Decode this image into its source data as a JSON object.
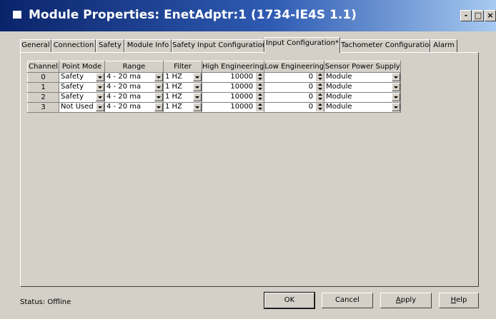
{
  "window": {
    "title": "Module Properties: EnetAdptr:1 (1734-IE4S 1.1)",
    "minimize_label": "-",
    "restore_label": "□",
    "close_label": "×"
  },
  "tabs": [
    {
      "label": "General"
    },
    {
      "label": "Connection"
    },
    {
      "label": "Safety"
    },
    {
      "label": "Module Info"
    },
    {
      "label": "Safety Input Configuration"
    },
    {
      "label": "Input Configuration*",
      "active": true
    },
    {
      "label": "Tachometer Configuration"
    },
    {
      "label": "Alarm"
    }
  ],
  "table": {
    "headers": [
      "Channel",
      "Point Mode",
      "Range",
      "Filter",
      "High Engineering",
      "Low Engineering",
      "Sensor Power Supply"
    ],
    "rows": [
      {
        "channel": "0",
        "point_mode": "Safety",
        "range": "4 - 20 ma",
        "filter": "1 HZ",
        "high": "10000",
        "low": "0",
        "power": "Module"
      },
      {
        "channel": "1",
        "point_mode": "Safety",
        "range": "4 - 20 ma",
        "filter": "1 HZ",
        "high": "10000",
        "low": "0",
        "power": "Module"
      },
      {
        "channel": "2",
        "point_mode": "Safety",
        "range": "4 - 20 ma",
        "filter": "1 HZ",
        "high": "10000",
        "low": "0",
        "power": "Module"
      },
      {
        "channel": "3",
        "point_mode": "Not Used",
        "range": "4 - 20 ma",
        "filter": "1 HZ",
        "high": "10000",
        "low": "0",
        "power": "Module"
      }
    ]
  },
  "footer": {
    "status_label": "Status:",
    "status_value": "Offline",
    "ok": "OK",
    "cancel": "Cancel",
    "apply_u": "A",
    "apply_rest": "pply",
    "help_u": "H",
    "help_rest": "elp"
  },
  "colors": {
    "titlebar_start": "#0a246a",
    "titlebar_end": "#a6caf0",
    "face": "#d4d0c8"
  }
}
